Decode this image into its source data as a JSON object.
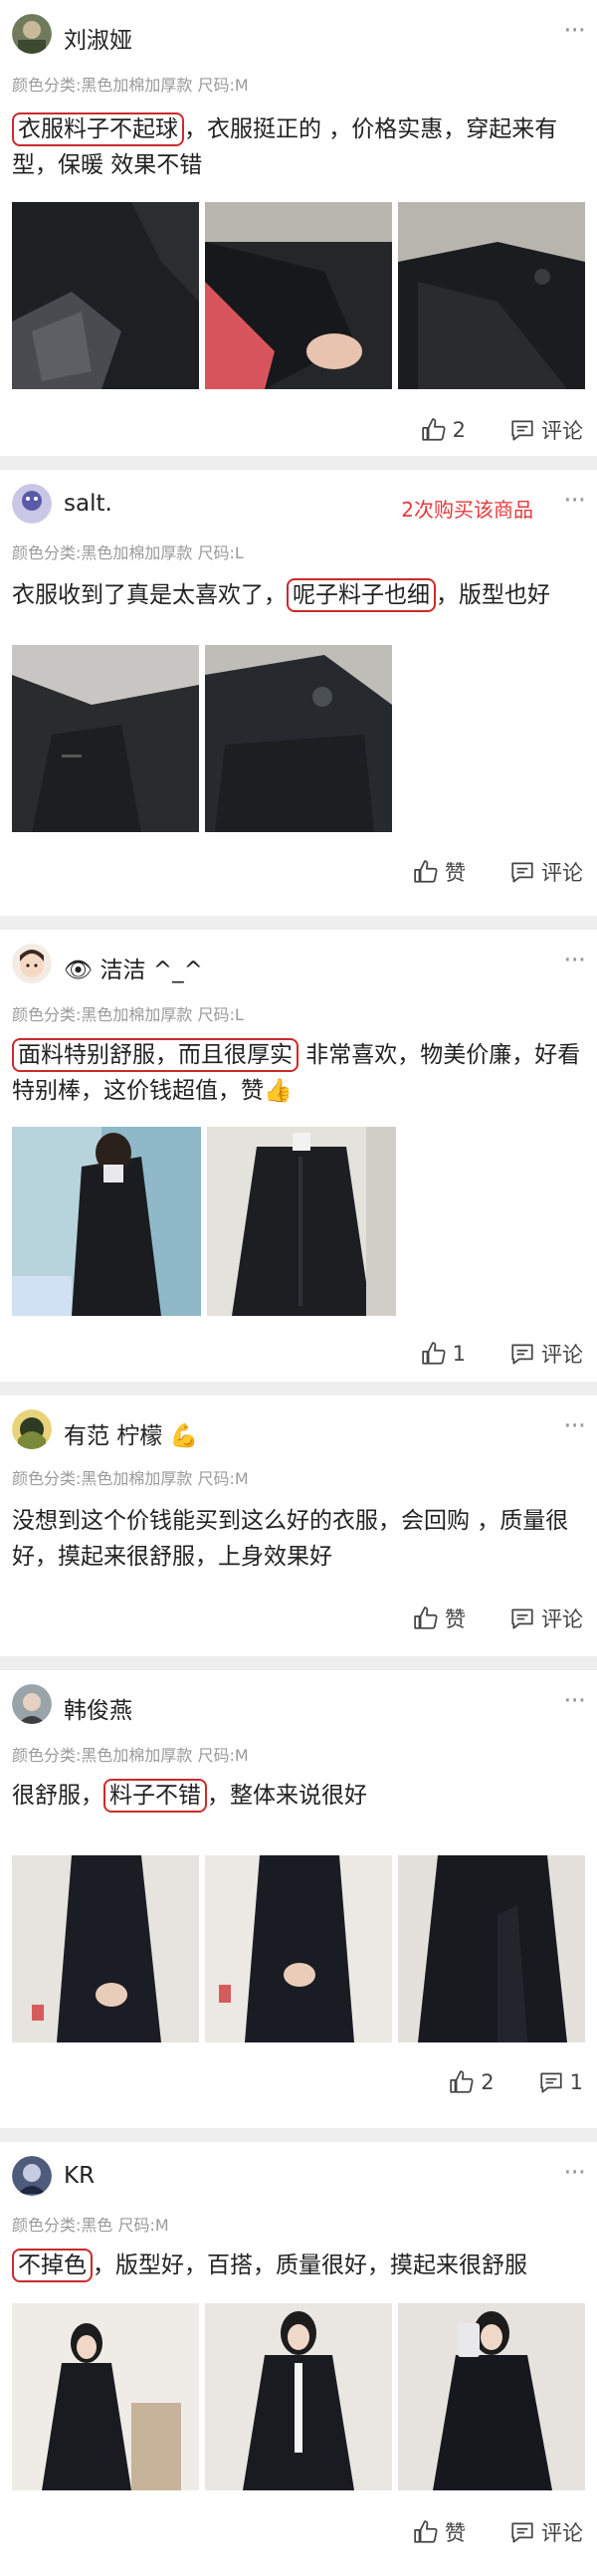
{
  "reviews": [
    {
      "username": "刘淑娅",
      "sku": "颜色分类:黑色加棉加厚款 尺码:M",
      "highlight": "衣服料子不起球",
      "text": "，衣服挺正的 ，价格实惠，穿起来有型，保暖 效果不错",
      "likes": "2",
      "comment_label": "评论",
      "more": "···"
    },
    {
      "username": "salt.",
      "sku": "颜色分类:黑色加棉加厚款 尺码:L",
      "buy_tag": "2次购买该商品",
      "text_before": "衣服收到了真是太喜欢了，",
      "highlight": "呢子料子也细",
      "text_after": "，版型也好",
      "likes": "赞",
      "comment_label": "评论",
      "more": "···"
    },
    {
      "username": "洁洁 ^_^",
      "sku": "颜色分类:黑色加棉加厚款 尺码:L",
      "highlight": "面料特别舒服，而且很厚实",
      "text": " 非常喜欢，物美价廉，好看特别棒，这价钱超值，赞",
      "likes": "1",
      "comment_label": "评论",
      "more": "···"
    },
    {
      "username": "有范 柠檬",
      "sku": "颜色分类:黑色加棉加厚款 尺码:M",
      "text": "没想到这个价钱能买到这么好的衣服，会回购 ，质量很好，摸起来很舒服，上身效果好",
      "likes": "赞",
      "comment_label": "评论",
      "more": "···"
    },
    {
      "username": "韩俊燕",
      "sku": "颜色分类:黑色加棉加厚款 尺码:M",
      "text_before": "很舒服，",
      "highlight": "料子不错",
      "text_after": "，整体来说很好",
      "likes": "2",
      "comments": "1",
      "more": "···"
    },
    {
      "username": "KR",
      "sku": "颜色分类:黑色 尺码:M",
      "highlight": "不掉色",
      "text": "，版型好，百搭，质量很好，摸起来很舒服",
      "likes": "赞",
      "comment_label": "评论",
      "more": "···"
    }
  ]
}
